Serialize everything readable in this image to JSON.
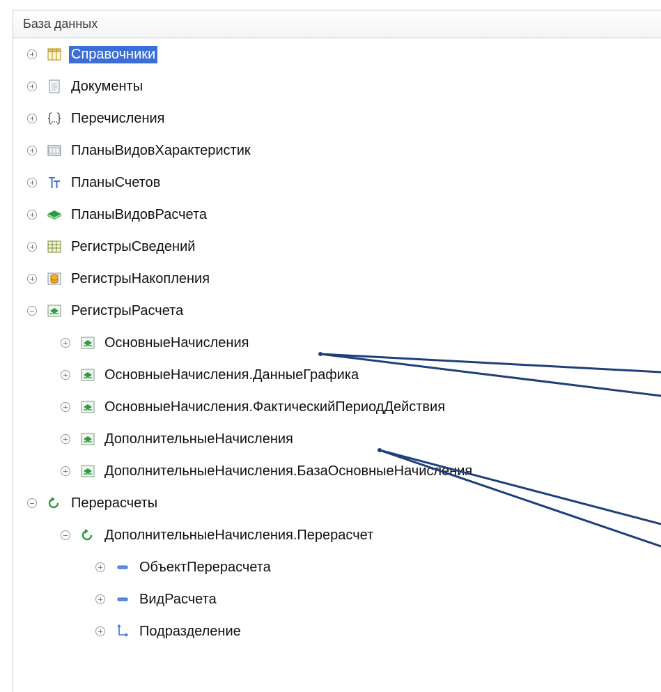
{
  "panel": {
    "title": "База данных"
  },
  "tree": {
    "items": [
      {
        "label": "Справочники",
        "icon": "catalog-icon",
        "expanded": false,
        "selected": true,
        "level": 0
      },
      {
        "label": "Документы",
        "icon": "document-icon",
        "expanded": false,
        "selected": false,
        "level": 0
      },
      {
        "label": "Перечисления",
        "icon": "enum-icon",
        "expanded": false,
        "selected": false,
        "level": 0
      },
      {
        "label": "ПланыВидовХарактеристик",
        "icon": "characteristic-types-icon",
        "expanded": false,
        "selected": false,
        "level": 0
      },
      {
        "label": "ПланыСчетов",
        "icon": "chart-of-accounts-icon",
        "expanded": false,
        "selected": false,
        "level": 0
      },
      {
        "label": "ПланыВидовРасчета",
        "icon": "calculation-types-icon",
        "expanded": false,
        "selected": false,
        "level": 0
      },
      {
        "label": "РегистрыСведений",
        "icon": "information-register-icon",
        "expanded": false,
        "selected": false,
        "level": 0
      },
      {
        "label": "РегистрыНакопления",
        "icon": "accumulation-register-icon",
        "expanded": false,
        "selected": false,
        "level": 0
      },
      {
        "label": "РегистрыРасчета",
        "icon": "calculation-register-icon",
        "expanded": true,
        "selected": false,
        "level": 0
      },
      {
        "label": "ОсновныеНачисления",
        "icon": "calculation-register-icon",
        "expanded": false,
        "selected": false,
        "level": 1
      },
      {
        "label": "ОсновныеНачисления.ДанныеГрафика",
        "icon": "calculation-register-icon",
        "expanded": false,
        "selected": false,
        "level": 1
      },
      {
        "label": "ОсновныеНачисления.ФактическийПериодДействия",
        "icon": "calculation-register-icon",
        "expanded": false,
        "selected": false,
        "level": 1
      },
      {
        "label": "ДополнительныеНачисления",
        "icon": "calculation-register-icon",
        "expanded": false,
        "selected": false,
        "level": 1
      },
      {
        "label": "ДополнительныеНачисления.БазаОсновныеНачисления",
        "icon": "calculation-register-icon",
        "expanded": false,
        "selected": false,
        "level": 1
      },
      {
        "label": "Перерасчеты",
        "icon": "recalculation-icon",
        "expanded": true,
        "selected": false,
        "level": 0
      },
      {
        "label": "ДополнительныеНачисления.Перерасчет",
        "icon": "recalculation-icon",
        "expanded": true,
        "selected": false,
        "level": 1
      },
      {
        "label": "ОбъектПерерасчета",
        "icon": "dimension-icon",
        "expanded": false,
        "selected": false,
        "level": 2
      },
      {
        "label": "ВидРасчета",
        "icon": "dimension-icon",
        "expanded": false,
        "selected": false,
        "level": 2
      },
      {
        "label": "Подразделение",
        "icon": "master-dimension-icon",
        "expanded": false,
        "selected": false,
        "level": 2
      }
    ]
  },
  "colors": {
    "selection": "#3b6ed6",
    "callout_line": "#1f3f7a",
    "register_green": "#2e9b3f"
  }
}
